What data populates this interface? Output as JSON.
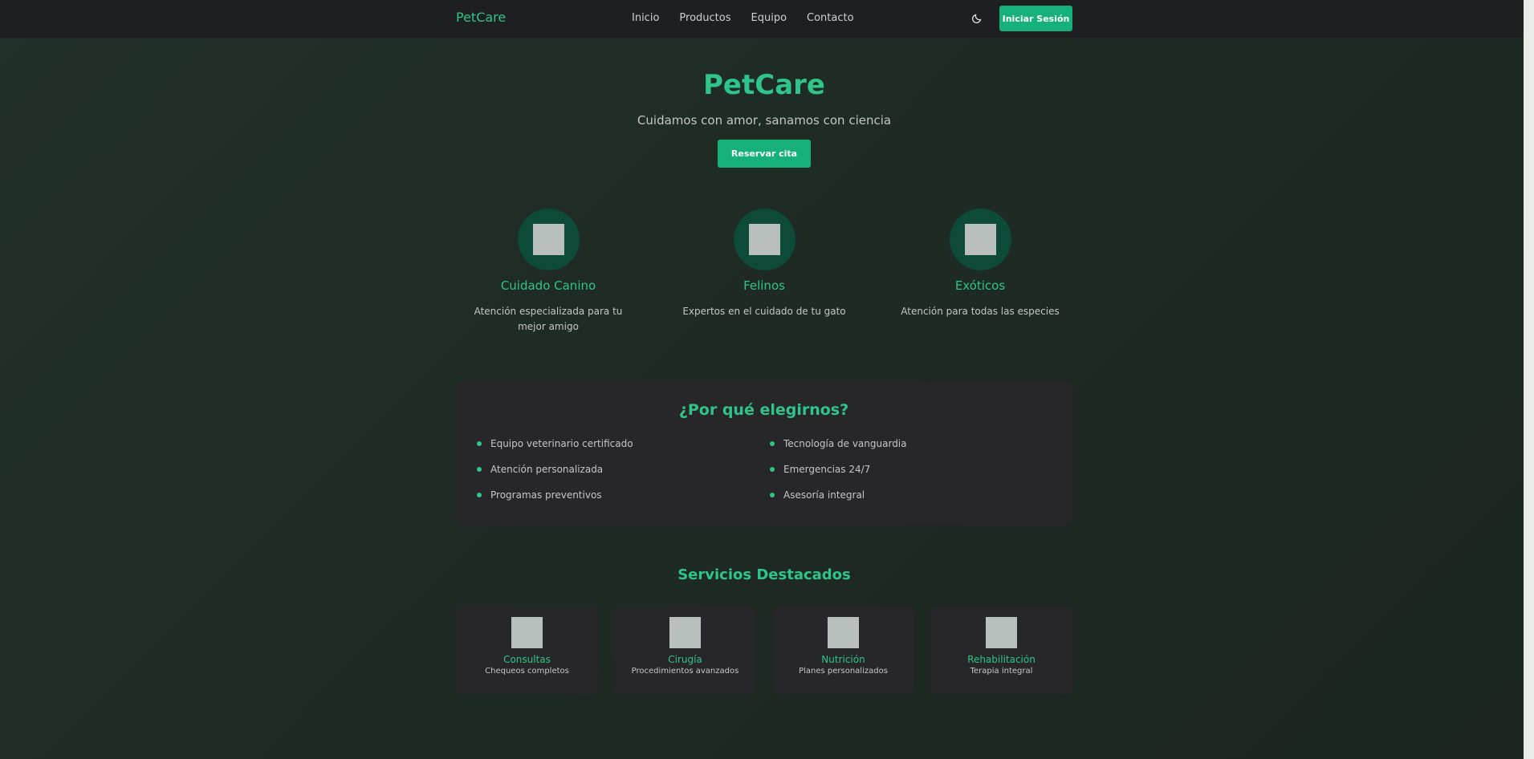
{
  "nav": {
    "brand": "PetCare",
    "links": [
      "Inicio",
      "Productos",
      "Equipo",
      "Contacto"
    ],
    "theme_icon": "moon-icon",
    "login_label": "Iniciar Sesión"
  },
  "hero": {
    "title": "PetCare",
    "subtitle": "Cuidamos con amor, sanamos con ciencia",
    "cta_label": "Reservar cita"
  },
  "features": [
    {
      "title": "Cuidado Canino",
      "desc": "Atención especializada para tu mejor amigo"
    },
    {
      "title": "Felinos",
      "desc": "Expertos en el cuidado de tu gato"
    },
    {
      "title": "Exóticos",
      "desc": "Atención para todas las especies"
    }
  ],
  "why": {
    "title": "¿Por qué elegirnos?",
    "left": [
      "Equipo veterinario certificado",
      "Atención personalizada",
      "Programas preventivos"
    ],
    "right": [
      "Tecnología de vanguardia",
      "Emergencias 24/7",
      "Asesoría integral"
    ]
  },
  "services": {
    "title": "Servicios Destacados",
    "items": [
      {
        "title": "Consultas",
        "desc": "Chequeos completos"
      },
      {
        "title": "Cirugía",
        "desc": "Procedimientos avanzados"
      },
      {
        "title": "Nutrición",
        "desc": "Planes personalizados"
      },
      {
        "title": "Rehabilitación",
        "desc": "Terapia integral"
      }
    ]
  },
  "colors": {
    "accent": "#2fc48a",
    "button": "#16b07a",
    "nav_bg": "#1d1f21",
    "card_bg": "#272729",
    "icon_circle": "#0d4a37"
  }
}
